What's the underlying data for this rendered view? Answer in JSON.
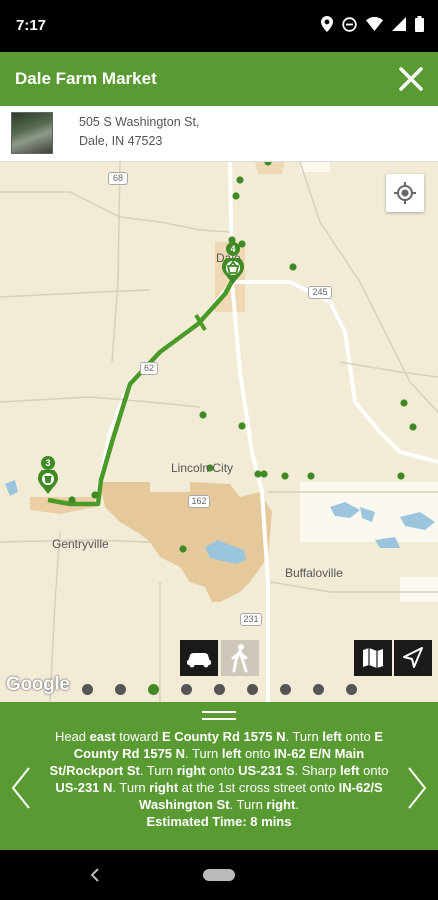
{
  "status_bar": {
    "time": "7:17"
  },
  "header": {
    "title": "Dale Farm Market"
  },
  "address": {
    "line1": "505 S Washington St,",
    "line2": "Dale, IN 47523"
  },
  "map": {
    "labels": {
      "dale": "Dale",
      "lincoln_city": "Lincoln City",
      "gentryville": "Gentryville",
      "buffaloville": "Buffaloville",
      "shield_68": "68",
      "shield_62": "62",
      "shield_245": "245",
      "shield_162": "162",
      "shield_231": "231"
    },
    "markers": {
      "start_number": "3",
      "end_number": "4"
    },
    "google": "Google",
    "colors": {
      "route": "#4a9a28",
      "marker": "#3f8a25"
    }
  },
  "pager": {
    "count": 9,
    "active_index": 2
  },
  "directions": {
    "t1": "Head ",
    "b1": "east",
    "t2": " toward ",
    "b2": "E County Rd 1575 N",
    "t3": ". Turn ",
    "b3": "left",
    "t4": " onto ",
    "b4": "E County Rd 1575 N",
    "t5": ". Turn ",
    "b5": "left",
    "t6": " onto ",
    "b6": "IN-62 E/N Main St/Rockport St",
    "t7": ". Turn ",
    "b7": "right",
    "t8": " onto ",
    "b8": "US-231 S",
    "t9": ". Sharp ",
    "b9": "left",
    "t10": " onto ",
    "b10": "US-231 N",
    "t11": ". Turn ",
    "b11": "right",
    "t12": " at the 1st cross street onto ",
    "b12": "IN-62/S Washington St",
    "t13": ". Turn ",
    "b13": "right",
    "t14": ".",
    "estimated": "Estimated Time: 8 mins"
  }
}
